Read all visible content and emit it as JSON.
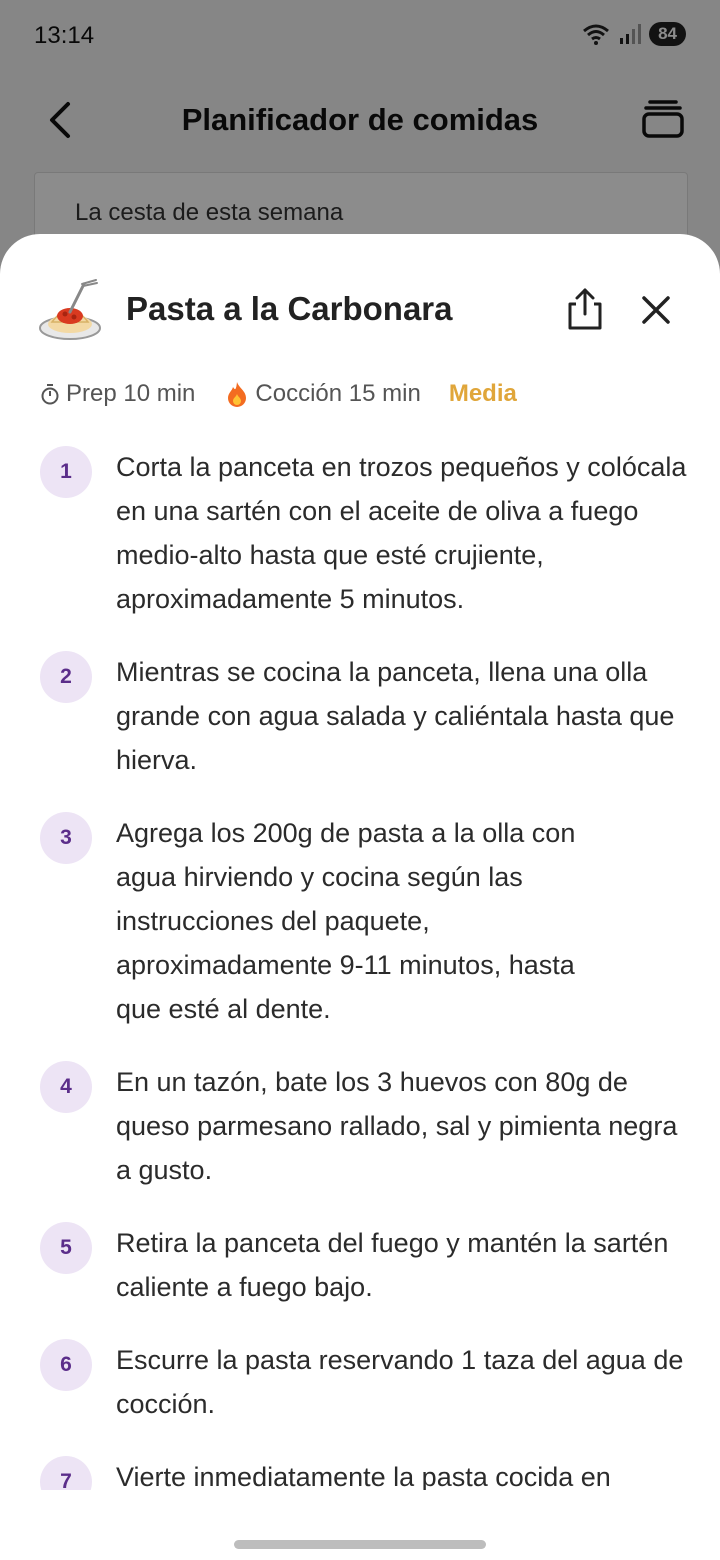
{
  "status_bar": {
    "time": "13:14",
    "battery": "84"
  },
  "header": {
    "title": "Planificador de comidas"
  },
  "basket": {
    "label": "La cesta de esta semana"
  },
  "recipe": {
    "title": "Pasta a la Carbonara",
    "prep": "Prep 10 min",
    "cook": "Cocción 15 min",
    "difficulty": "Media"
  },
  "steps": [
    {
      "num": "1",
      "text": "Corta la panceta en trozos pequeños y colócala en una sartén con el aceite de oliva a fuego medio-alto hasta que esté crujiente, aproximadamente 5 minutos."
    },
    {
      "num": "2",
      "text": "Mientras se cocina la panceta, llena una olla grande con agua salada y caliéntala hasta que hierva."
    },
    {
      "num": "3",
      "text": "Agrega los 200g de pasta a la olla con agua hirviendo y cocina según las instrucciones del paquete, aproximadamente 9-11 minutos, hasta que esté al dente."
    },
    {
      "num": "4",
      "text": "En un tazón, bate los 3 huevos con 80g de queso parmesano rallado, sal y pimienta negra a gusto."
    },
    {
      "num": "5",
      "text": "Retira la panceta del fuego y mantén la sartén caliente a fuego bajo."
    },
    {
      "num": "6",
      "text": "Escurre la pasta reservando 1 taza del agua de cocción."
    },
    {
      "num": "7",
      "text": "Vierte inmediatamente la pasta cocida en"
    }
  ],
  "colors": {
    "accent": "#5b2d8a",
    "step_bg": "#ede4f5",
    "difficulty": "#e0a63a"
  }
}
